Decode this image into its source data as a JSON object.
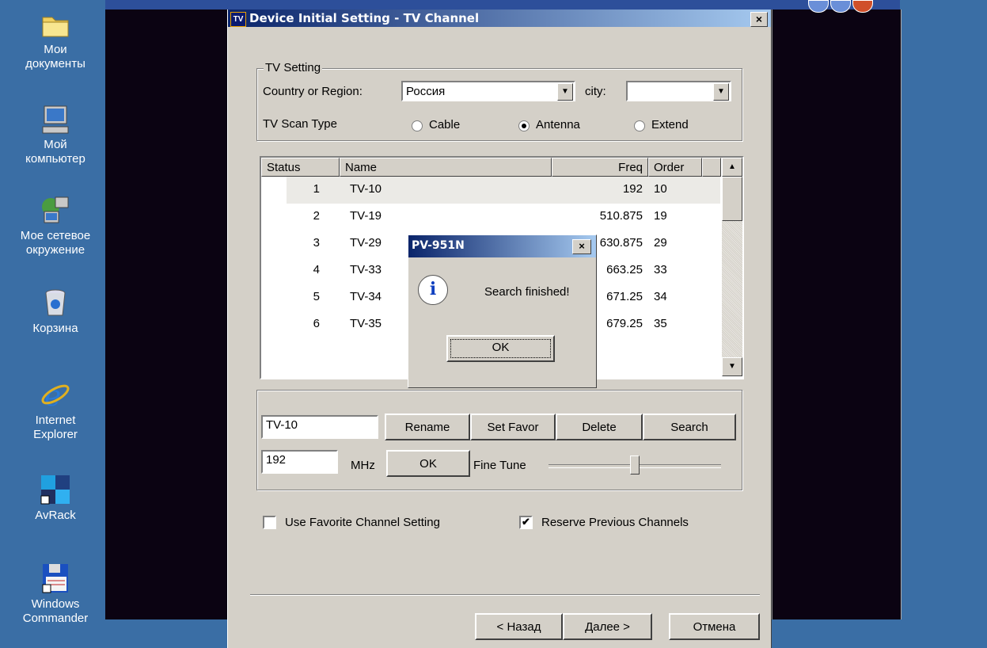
{
  "desktop": {
    "icons": [
      {
        "label_line1": "Мои",
        "label_line2": "документы",
        "icon": "folder-icon"
      },
      {
        "label_line1": "Мой",
        "label_line2": "компьютер",
        "icon": "computer-icon"
      },
      {
        "label_line1": "Мое сетевое",
        "label_line2": "окружение",
        "icon": "network-icon"
      },
      {
        "label_line1": "Корзина",
        "label_line2": "",
        "icon": "recycle-bin-icon"
      },
      {
        "label_line1": "Internet",
        "label_line2": "Explorer",
        "icon": "ie-icon"
      },
      {
        "label_line1": "AvRack",
        "label_line2": "",
        "icon": "avrack-icon"
      },
      {
        "label_line1": "Windows",
        "label_line2": "Commander",
        "icon": "floppy-icon"
      }
    ]
  },
  "wizard": {
    "app_icon_text": "TV",
    "title": "Device Initial Setting - TV Channel",
    "close": "×",
    "tv_setting": {
      "legend": "TV Setting",
      "country_label": "Country or Region:",
      "country_value": "Россия",
      "city_label": "city:",
      "city_value": "",
      "scan_label": "TV Scan Type",
      "scan_options": [
        "Cable",
        "Antenna",
        "Extend"
      ],
      "scan_selected": "Antenna"
    },
    "table": {
      "headers": [
        "Status",
        "Name",
        "Freq",
        "Order"
      ],
      "rows": [
        {
          "status": "1",
          "name": "TV-10",
          "freq": "192",
          "order": "10"
        },
        {
          "status": "2",
          "name": "TV-19",
          "freq": "510.875",
          "order": "19"
        },
        {
          "status": "3",
          "name": "TV-29",
          "freq": "630.875",
          "order": "29"
        },
        {
          "status": "4",
          "name": "TV-33",
          "freq": "663.25",
          "order": "33"
        },
        {
          "status": "5",
          "name": "TV-34",
          "freq": "671.25",
          "order": "34"
        },
        {
          "status": "6",
          "name": "TV-35",
          "freq": "679.25",
          "order": "35"
        }
      ]
    },
    "edit": {
      "name_value": "TV-10",
      "rename": "Rename",
      "set_favor": "Set Favor",
      "delete": "Delete",
      "search": "Search",
      "freq_value": "192",
      "mhz": "MHz",
      "ok": "OK",
      "fine_tune": "Fine Tune",
      "fine_tune_level": 0.5
    },
    "use_favorite_label": "Use Favorite Channel Setting",
    "use_favorite_checked": false,
    "reserve_label": "Reserve Previous Channels",
    "reserve_checked": true,
    "check_mark": "✔",
    "nav": {
      "back": "< Назад",
      "next": "Далее >",
      "cancel": "Отмена"
    }
  },
  "msgbox": {
    "title": "PV-951N",
    "close": "×",
    "icon": "i",
    "message": "Search finished!",
    "ok": "OK"
  }
}
